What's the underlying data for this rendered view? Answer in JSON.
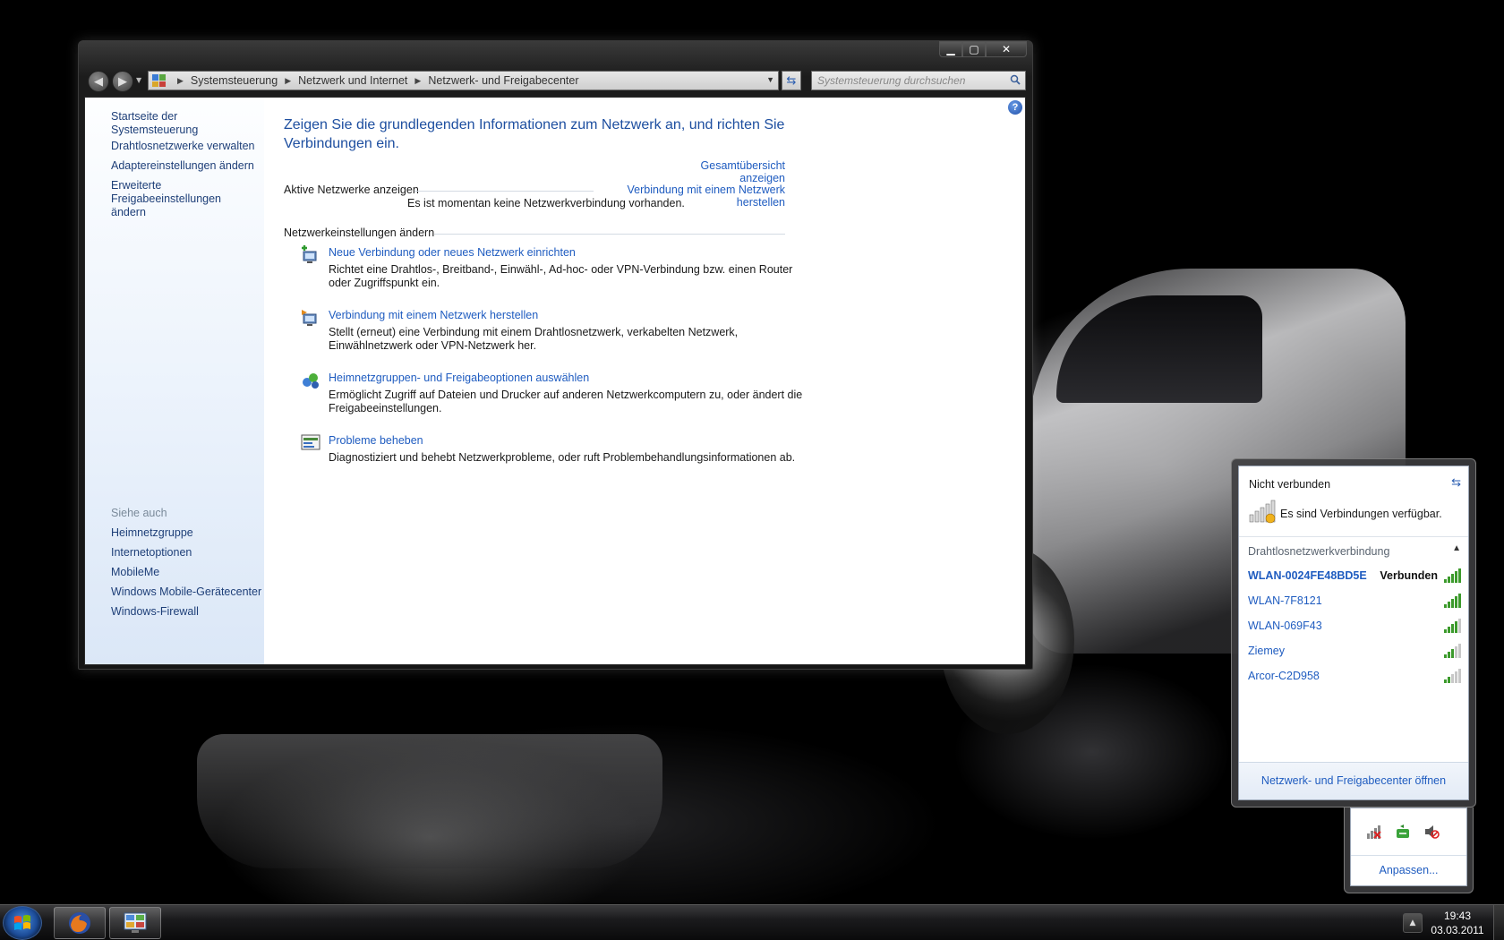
{
  "window": {
    "address": {
      "crumbs": [
        "Systemsteuerung",
        "Netzwerk und Internet",
        "Netzwerk- und Freigabecenter"
      ]
    },
    "search_placeholder": "Systemsteuerung durchsuchen",
    "left_pane": {
      "home": "Startseite der Systemsteuerung",
      "links": [
        "Drahtlosnetzwerke verwalten",
        "Adaptereinstellungen ändern",
        "Erweiterte Freigabeeinstellungen ändern"
      ],
      "see_also_heading": "Siehe auch",
      "see_also": [
        "Heimnetzgruppe",
        "Internetoptionen",
        "MobileMe",
        "Windows Mobile-Gerätecenter",
        "Windows-Firewall"
      ]
    },
    "main": {
      "title": "Zeigen Sie die grundlegenden Informationen zum Netzwerk an, und richten Sie Verbindungen ein.",
      "overview_link": "Gesamtübersicht anzeigen",
      "active_networks_label": "Aktive Netzwerke anzeigen",
      "connect_link": "Verbindung mit einem Netzwerk herstellen",
      "no_connection_text": "Es ist momentan keine Netzwerkverbindung vorhanden.",
      "settings_label": "Netzwerkeinstellungen ändern",
      "tasks": [
        {
          "title": "Neue Verbindung oder neues Netzwerk einrichten",
          "desc": "Richtet eine Drahtlos-, Breitband-, Einwähl-, Ad-hoc- oder VPN-Verbindung bzw. einen Router oder Zugriffspunkt ein.",
          "icon": "new-connection-icon"
        },
        {
          "title": "Verbindung mit einem Netzwerk herstellen",
          "desc": "Stellt (erneut) eine Verbindung mit einem Drahtlosnetzwerk, verkabelten Netzwerk, Einwählnetzwerk oder VPN-Netzwerk her.",
          "icon": "connect-network-icon"
        },
        {
          "title": "Heimnetzgruppen- und Freigabeoptionen auswählen",
          "desc": "Ermöglicht Zugriff auf Dateien und Drucker auf anderen Netzwerkcomputern zu, oder ändert die Freigabeeinstellungen.",
          "icon": "homegroup-icon"
        },
        {
          "title": "Probleme beheben",
          "desc": "Diagnostiziert und behebt Netzwerkprobleme, oder ruft Problembehandlungsinformationen ab.",
          "icon": "troubleshoot-icon"
        }
      ]
    }
  },
  "flyout": {
    "status": "Nicht verbunden",
    "available_text": "Es sind Verbindungen verfügbar.",
    "group": "Drahtlosnetzwerkverbindung",
    "networks": [
      {
        "name": "WLAN-0024FE48BD5E",
        "status": "Verbunden",
        "signal": 5
      },
      {
        "name": "WLAN-7F8121",
        "status": "",
        "signal": 5
      },
      {
        "name": "WLAN-069F43",
        "status": "",
        "signal": 4
      },
      {
        "name": "Ziemey",
        "status": "",
        "signal": 3
      },
      {
        "name": "Arcor-C2D958",
        "status": "",
        "signal": 2
      }
    ],
    "footer_link": "Netzwerk- und Freigabecenter öffnen"
  },
  "tray_overflow": {
    "customize_link": "Anpassen..."
  },
  "taskbar": {
    "time": "19:43",
    "date": "03.03.2011"
  },
  "colors": {
    "link": "#1f5cc0",
    "title": "#1e4fa0",
    "signal_green": "#3c9a2c"
  }
}
